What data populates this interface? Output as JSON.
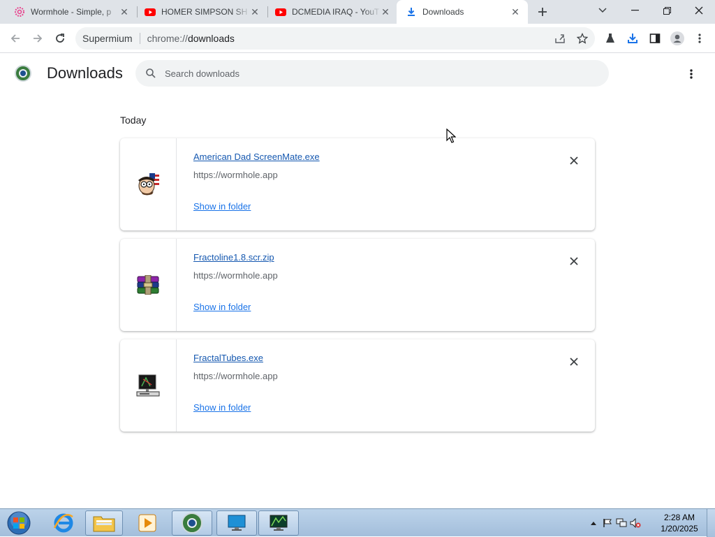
{
  "tabs": [
    {
      "title": "Wormhole - Simple, p",
      "icon": "wormhole-icon",
      "active": false
    },
    {
      "title": "HOMER SIMPSON SH",
      "icon": "youtube-icon",
      "active": false
    },
    {
      "title": "DCMEDIA IRAQ - YouT",
      "icon": "youtube-icon",
      "active": false
    },
    {
      "title": "Downloads",
      "icon": "download-icon",
      "active": true
    }
  ],
  "omnibox": {
    "chip": "Supermium",
    "url_scheme": "chrome://",
    "url_host": "downloads"
  },
  "page": {
    "title": "Downloads",
    "search_placeholder": "Search downloads",
    "section_label": "Today",
    "items": [
      {
        "filename": "American Dad ScreenMate.exe",
        "source": "https://wormhole.app",
        "action": "Show in folder",
        "icon": "american-dad-icon"
      },
      {
        "filename": "Fractoline1.8.scr.zip",
        "source": "https://wormhole.app",
        "action": "Show in folder",
        "icon": "winrar-archive-icon"
      },
      {
        "filename": "FractalTubes.exe",
        "source": "https://wormhole.app",
        "action": "Show in folder",
        "icon": "computer-exe-icon"
      }
    ]
  },
  "taskbar": {
    "time": "2:28 AM",
    "date": "1/20/2025"
  },
  "colors": {
    "accent": "#1a73e8",
    "tabstrip": "#dfe3e8",
    "taskbar": "#a3bedb"
  }
}
